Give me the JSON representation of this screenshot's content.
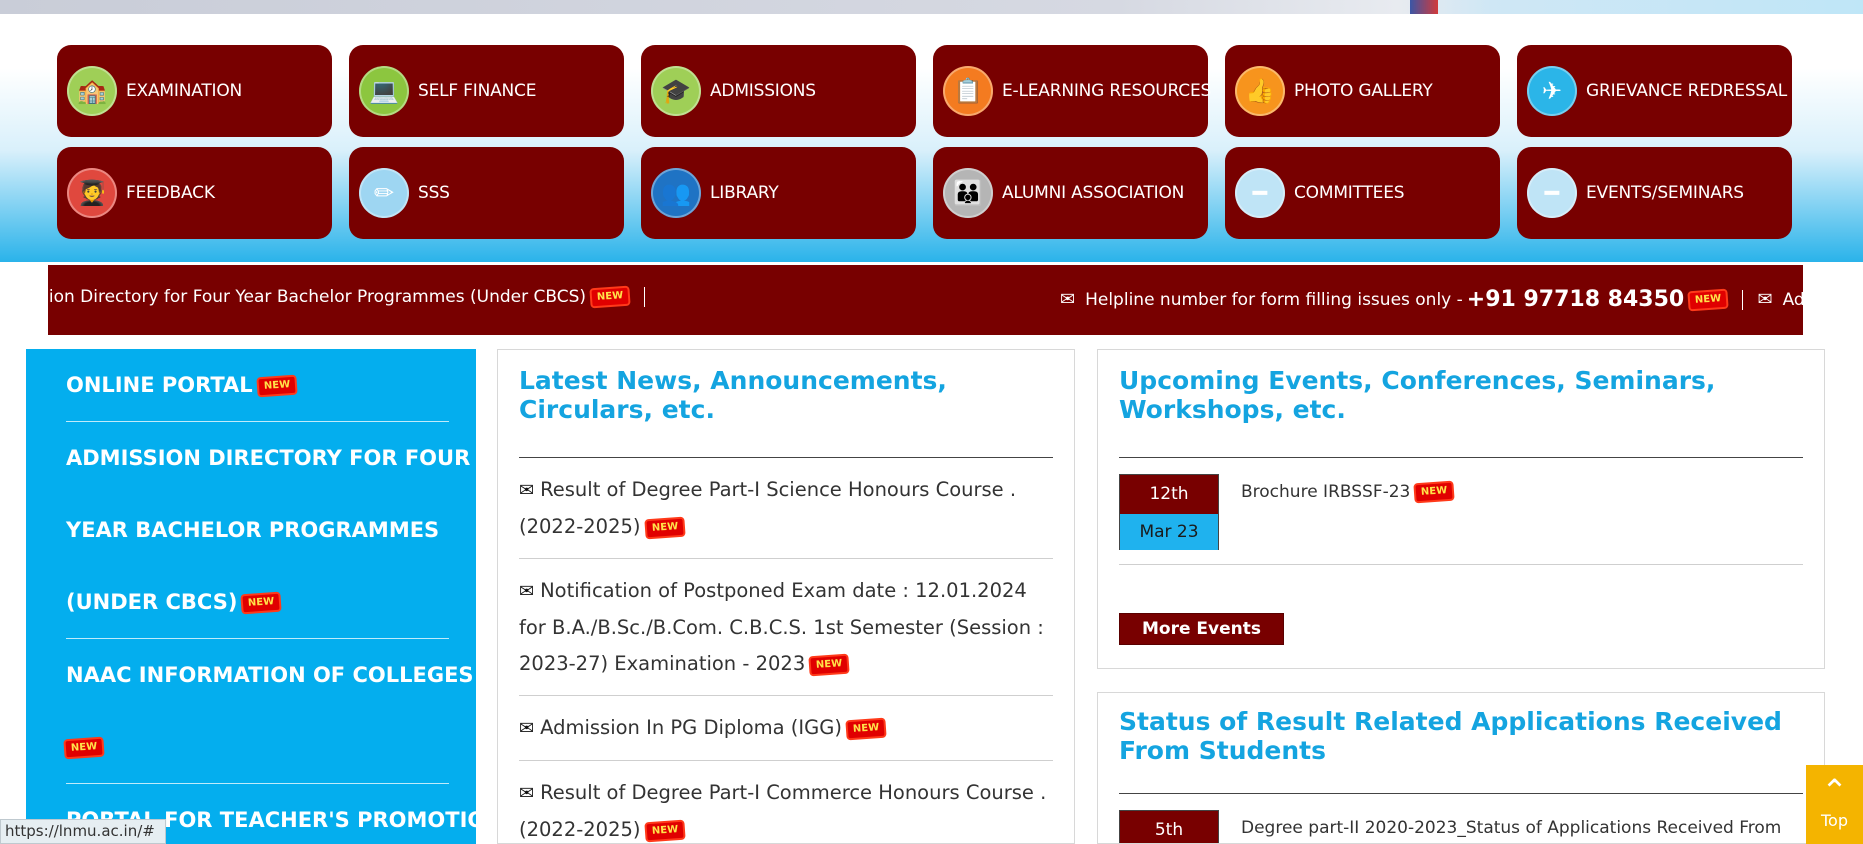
{
  "quick_links": [
    {
      "label": "EXAMINATION",
      "icon": "school-building-icon",
      "icon_bg": "#9fcf57",
      "glyph": "🏫"
    },
    {
      "label": "SELF FINANCE",
      "icon": "laptop-finance-icon",
      "icon_bg": "#8cc63f",
      "glyph": "💻"
    },
    {
      "label": "ADMISSIONS",
      "icon": "graduation-cap-icon",
      "icon_bg": "#9fcf57",
      "glyph": "🎓"
    },
    {
      "label": "E-LEARNING RESOURCES",
      "icon": "presentation-board-icon",
      "icon_bg": "#f47b20",
      "glyph": "📋"
    },
    {
      "label": "PHOTO GALLERY",
      "icon": "thumbs-up-icon",
      "icon_bg": "#f7941d",
      "glyph": "👍"
    },
    {
      "label": "GRIEVANCE REDRESSAL",
      "icon": "airplane-icon",
      "icon_bg": "#2bb5e8",
      "glyph": "✈"
    },
    {
      "label": "FEEDBACK",
      "icon": "graduate-person-icon",
      "icon_bg": "#e0483e",
      "glyph": "🧑‍🎓"
    },
    {
      "label": "SSS",
      "icon": "pencil-icon",
      "icon_bg": "#9ed6f2",
      "glyph": "✏"
    },
    {
      "label": "LIBRARY",
      "icon": "people-group-icon",
      "icon_bg": "#1f73c4",
      "glyph": "👥"
    },
    {
      "label": "ALUMNI ASSOCIATION",
      "icon": "alumni-group-icon",
      "icon_bg": "#b5b5b5",
      "glyph": "👪"
    },
    {
      "label": "COMMITTEES",
      "icon": "minus-circle-icon",
      "icon_bg": "#bfe4f6",
      "glyph": "━"
    },
    {
      "label": "EVENTS/SEMINARS",
      "icon": "minus-circle-icon",
      "icon_bg": "#bfe4f6",
      "glyph": "━"
    }
  ],
  "ticker": {
    "item1": "sion Directory for Four Year Bachelor Programmes (Under CBCS)",
    "item2_prefix": "Helpline number for form filling issues only -",
    "item2_phone": "+91 97718 84350",
    "item3": "Ad",
    "new_label": "NEW"
  },
  "left_nav": [
    {
      "label": "ONLINE PORTAL",
      "new": true
    },
    {
      "label": "ADMISSION DIRECTORY FOR FOUR YEAR BACHELOR PROGRAMMES (UNDER CBCS)",
      "lines": [
        "ADMISSION DIRECTORY FOR FOUR",
        "YEAR BACHELOR PROGRAMMES",
        "(UNDER CBCS)"
      ],
      "new": true
    },
    {
      "label": "NAAC INFORMATION OF COLLEGES",
      "new": true
    },
    {
      "label": "PORTAL FOR TEACHER'S PROMOTION",
      "new": false
    }
  ],
  "news": {
    "title": "Latest News, Announcements, Circulars, etc.",
    "items": [
      "Result of Degree Part-I Science Honours Course . (2022-2025)",
      "Notification of Postponed Exam date : 12.01.2024 for B.A./B.Sc./B.Com. C.B.C.S. 1st Semester (Session : 2023-27) Examination - 2023",
      "Admission In PG Diploma (IGG)",
      "Result of Degree Part-I Commerce Honours Course . (2022-2025)"
    ]
  },
  "events": {
    "title": "Upcoming Events, Conferences, Seminars, Workshops, etc.",
    "items": [
      {
        "day": "12th",
        "month": "Mar 23",
        "text": "Brochure IRBSSF-23"
      }
    ],
    "more_label": "More Events"
  },
  "status": {
    "title": "Status of Result Related Applications Received From Students",
    "items": [
      {
        "day": "5th",
        "text": "Degree part-II 2020-2023_Status of Applications Received From"
      }
    ]
  },
  "status_bar_url": "https://lnmu.ac.in/#",
  "top_button_label": "Top",
  "colors": {
    "maroon": "#780000",
    "sky": "#04aeee",
    "heading": "#14a4e0",
    "top_btn": "#f4b400"
  }
}
